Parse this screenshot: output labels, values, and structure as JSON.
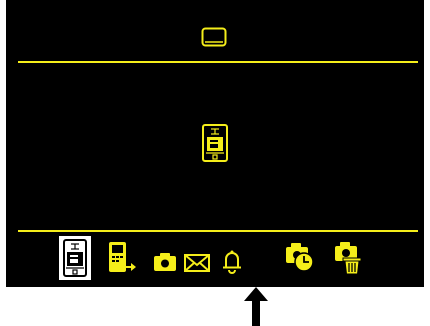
{
  "colors": {
    "background": "#000000",
    "accent": "#f5ee1a",
    "selected_frame": "#ffffff"
  },
  "header": {
    "icon": "display-icon"
  },
  "main": {
    "icon": "panel-switch-icon"
  },
  "toolbar": {
    "selected_index": 0,
    "items": [
      {
        "name": "panel-switch",
        "icon": "panel-switch-icon",
        "selected": true
      },
      {
        "name": "export",
        "icon": "device-export-icon",
        "selected": false
      },
      {
        "name": "camera",
        "icon": "camera-icon",
        "selected": false
      },
      {
        "name": "mail",
        "icon": "envelope-icon",
        "selected": false
      },
      {
        "name": "alarm",
        "icon": "bell-icon",
        "selected": false
      },
      {
        "name": "timer-camera",
        "icon": "camera-clock-icon",
        "selected": false
      },
      {
        "name": "trash-camera",
        "icon": "camera-trash-icon",
        "selected": false
      }
    ]
  },
  "pointer": {
    "icon": "up-arrow-icon"
  }
}
